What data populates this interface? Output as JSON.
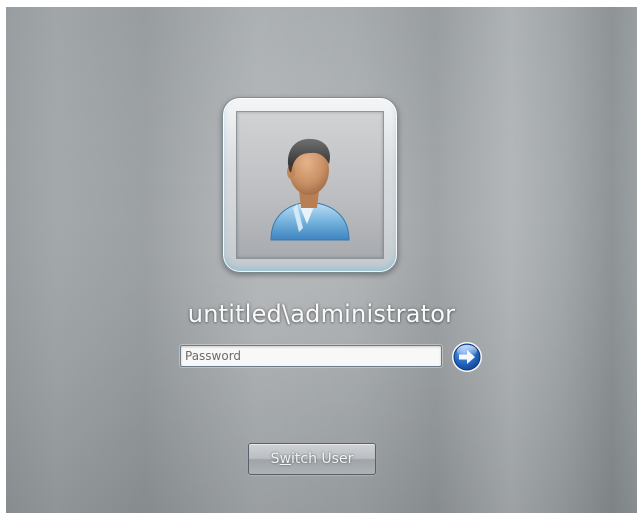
{
  "user": {
    "name": "untitled\\administrator",
    "avatar_icon": "user-avatar-icon"
  },
  "login": {
    "password_placeholder": "Password",
    "password_value": "",
    "submit_icon": "arrow-right-icon",
    "accent_color": "#2a6fd0"
  },
  "switch_user": {
    "label_prefix": "S",
    "label_accel": "w",
    "label_suffix": "itch User"
  }
}
